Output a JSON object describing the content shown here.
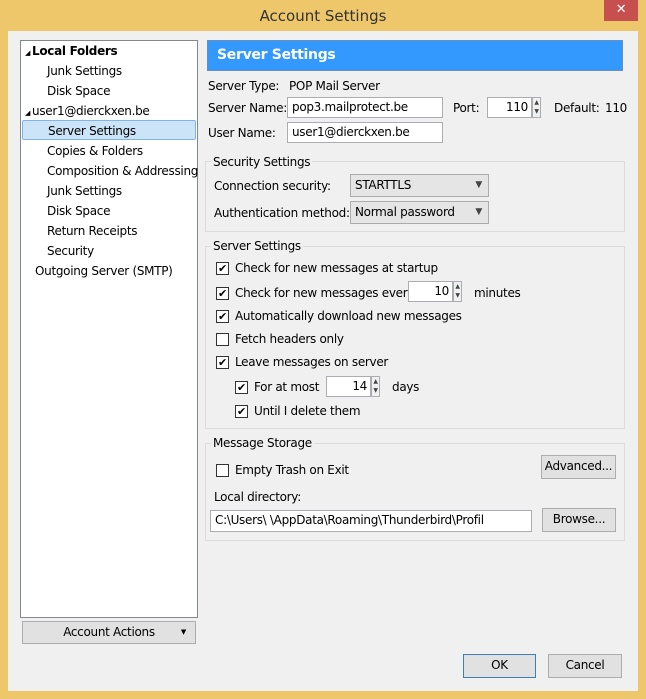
{
  "window": {
    "title": "Account Settings",
    "close_icon": "close-icon"
  },
  "tree": {
    "items": [
      {
        "label": "Local Folders",
        "level": 0,
        "bold": true,
        "expanded": true
      },
      {
        "label": "Junk Settings",
        "level": 1
      },
      {
        "label": "Disk Space",
        "level": 1
      },
      {
        "label": "user1@dierckxen.be",
        "level": 0,
        "expanded": true
      },
      {
        "label": "Server Settings",
        "level": 1,
        "selected": true
      },
      {
        "label": "Copies & Folders",
        "level": 1
      },
      {
        "label": "Composition & Addressing",
        "level": 1
      },
      {
        "label": "Junk Settings",
        "level": 1
      },
      {
        "label": "Disk Space",
        "level": 1
      },
      {
        "label": "Return Receipts",
        "level": 1
      },
      {
        "label": "Security",
        "level": 1
      },
      {
        "label": "Outgoing Server (SMTP)",
        "level": 0
      }
    ]
  },
  "account_actions": "Account Actions",
  "header": {
    "title": "Server Settings",
    "color": "#3399ff"
  },
  "server": {
    "type_label": "Server Type:",
    "type_value": "POP Mail Server",
    "name_label": "Server Name:",
    "name_value": "pop3.mailprotect.be",
    "port_label": "Port:",
    "port_value": "110",
    "default_label": "Default:",
    "default_value": "110",
    "user_label": "User Name:",
    "user_value": "user1@dierckxen.be"
  },
  "security": {
    "title": "Security Settings",
    "conn_label": "Connection security:",
    "conn_value": "STARTTLS",
    "auth_label": "Authentication method:",
    "auth_value": "Normal password"
  },
  "settings": {
    "title": "Server Settings",
    "startup": {
      "label": "Check for new messages at startup",
      "checked": true
    },
    "every": {
      "label": "Check for new messages every",
      "checked": true,
      "value": "10",
      "unit": "minutes"
    },
    "auto": {
      "label": "Automatically download new messages",
      "checked": true
    },
    "headers": {
      "label": "Fetch headers only",
      "checked": false
    },
    "leave": {
      "label": "Leave messages on server",
      "checked": true
    },
    "atmost": {
      "label": "For at most",
      "checked": true,
      "value": "14",
      "unit": "days"
    },
    "until": {
      "label": "Until I delete them",
      "checked": true
    }
  },
  "storage": {
    "title": "Message Storage",
    "empty_trash": {
      "label": "Empty Trash on Exit",
      "checked": false
    },
    "advanced": "Advanced...",
    "dir_label": "Local directory:",
    "dir_value": "C:\\Users\\                 \\AppData\\Roaming\\Thunderbird\\Profil",
    "browse": "Browse..."
  },
  "buttons": {
    "ok": "OK",
    "cancel": "Cancel"
  }
}
